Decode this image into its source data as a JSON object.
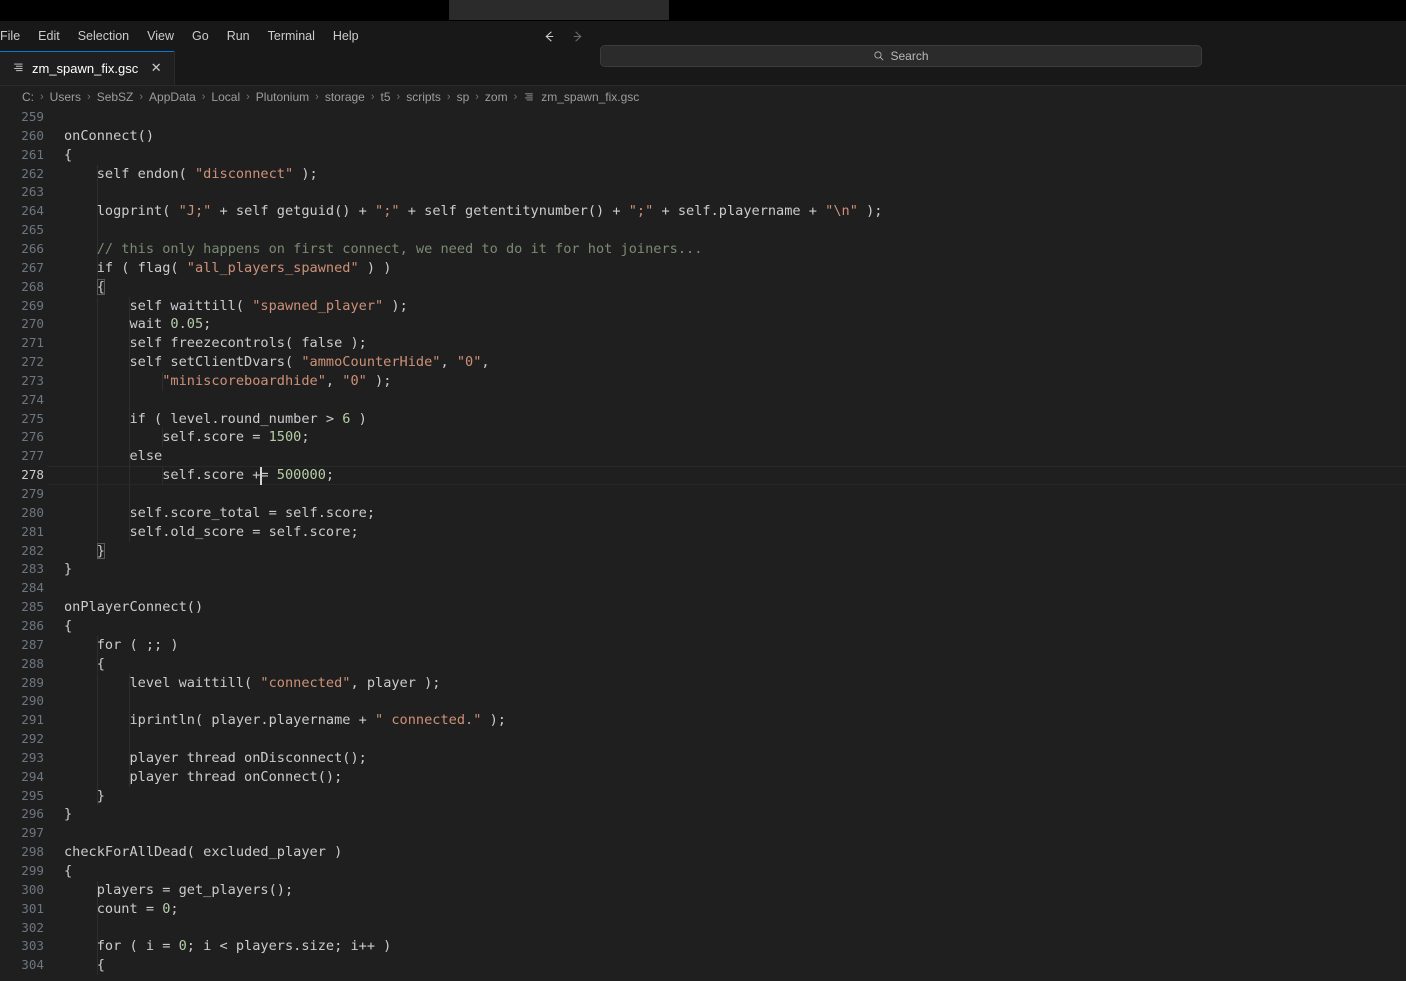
{
  "browser_strip": {
    "tabs": [
      {
        "label": "",
        "favicon": false
      },
      {
        "label": "",
        "favicon": false
      },
      {
        "label": "",
        "favicon": false
      }
    ]
  },
  "titlebar": {
    "menus": [
      "File",
      "Edit",
      "Selection",
      "View",
      "Go",
      "Run",
      "Terminal",
      "Help"
    ],
    "back_icon": "arrow-left-icon",
    "forward_icon": "arrow-right-icon",
    "search": {
      "placeholder": "Search",
      "icon": "search-icon"
    }
  },
  "tabs": [
    {
      "title": "zm_spawn_fix.gsc",
      "icon": "gsc-file-icon",
      "close_label": "✕",
      "active": true
    }
  ],
  "breadcrumb": {
    "separator": "›",
    "segments": [
      "C:",
      "Users",
      "SebSZ",
      "AppData",
      "Local",
      "Plutonium",
      "storage",
      "t5",
      "scripts",
      "sp",
      "zom"
    ],
    "file": "zm_spawn_fix.gsc",
    "file_icon": "gsc-file-icon"
  },
  "editor": {
    "active_line": 278,
    "first_line": 259,
    "colors": {
      "background": "#1f1f1f",
      "foreground": "#cccccc",
      "line_number": "#6e7681",
      "line_number_active": "#cccccc",
      "string": "#ce9178",
      "number": "#b5cea8",
      "comment": "#7b8b73",
      "accent": "#0078d4",
      "indent_guide": "#2e2e2e"
    },
    "lines": [
      {
        "n": 259,
        "text": ""
      },
      {
        "n": 260,
        "text": "onConnect()"
      },
      {
        "n": 261,
        "text": "{"
      },
      {
        "n": 262,
        "text": "    self endon( \"disconnect\" );"
      },
      {
        "n": 263,
        "text": ""
      },
      {
        "n": 264,
        "text": "    logprint( \"J;\" + self getguid() + \";\" + self getentitynumber() + \";\" + self.playername + \"\\n\" );"
      },
      {
        "n": 265,
        "text": ""
      },
      {
        "n": 266,
        "text": "    // this only happens on first connect, we need to do it for hot joiners..."
      },
      {
        "n": 267,
        "text": "    if ( flag( \"all_players_spawned\" ) )"
      },
      {
        "n": 268,
        "text": "    {"
      },
      {
        "n": 269,
        "text": "        self waittill( \"spawned_player\" );"
      },
      {
        "n": 270,
        "text": "        wait 0.05;"
      },
      {
        "n": 271,
        "text": "        self freezecontrols( false );"
      },
      {
        "n": 272,
        "text": "        self setClientDvars( \"ammoCounterHide\", \"0\","
      },
      {
        "n": 273,
        "text": "            \"miniscoreboardhide\", \"0\" );"
      },
      {
        "n": 274,
        "text": ""
      },
      {
        "n": 275,
        "text": "        if ( level.round_number > 6 )"
      },
      {
        "n": 276,
        "text": "            self.score = 1500;"
      },
      {
        "n": 277,
        "text": "        else"
      },
      {
        "n": 278,
        "text": "            self.score += 500000;"
      },
      {
        "n": 279,
        "text": ""
      },
      {
        "n": 280,
        "text": "        self.score_total = self.score;"
      },
      {
        "n": 281,
        "text": "        self.old_score = self.score;"
      },
      {
        "n": 282,
        "text": "    }"
      },
      {
        "n": 283,
        "text": "}"
      },
      {
        "n": 284,
        "text": ""
      },
      {
        "n": 285,
        "text": "onPlayerConnect()"
      },
      {
        "n": 286,
        "text": "{"
      },
      {
        "n": 287,
        "text": "    for ( ;; )"
      },
      {
        "n": 288,
        "text": "    {"
      },
      {
        "n": 289,
        "text": "        level waittill( \"connected\", player );"
      },
      {
        "n": 290,
        "text": ""
      },
      {
        "n": 291,
        "text": "        iprintln( player.playername + \" connected.\" );"
      },
      {
        "n": 292,
        "text": ""
      },
      {
        "n": 293,
        "text": "        player thread onDisconnect();"
      },
      {
        "n": 294,
        "text": "        player thread onConnect();"
      },
      {
        "n": 295,
        "text": "    }"
      },
      {
        "n": 296,
        "text": "}"
      },
      {
        "n": 297,
        "text": ""
      },
      {
        "n": 298,
        "text": "checkForAllDead( excluded_player )"
      },
      {
        "n": 299,
        "text": "{"
      },
      {
        "n": 300,
        "text": "    players = get_players();"
      },
      {
        "n": 301,
        "text": "    count = 0;"
      },
      {
        "n": 302,
        "text": ""
      },
      {
        "n": 303,
        "text": "    for ( i = 0; i < players.size; i++ )"
      },
      {
        "n": 304,
        "text": "    {"
      }
    ]
  }
}
